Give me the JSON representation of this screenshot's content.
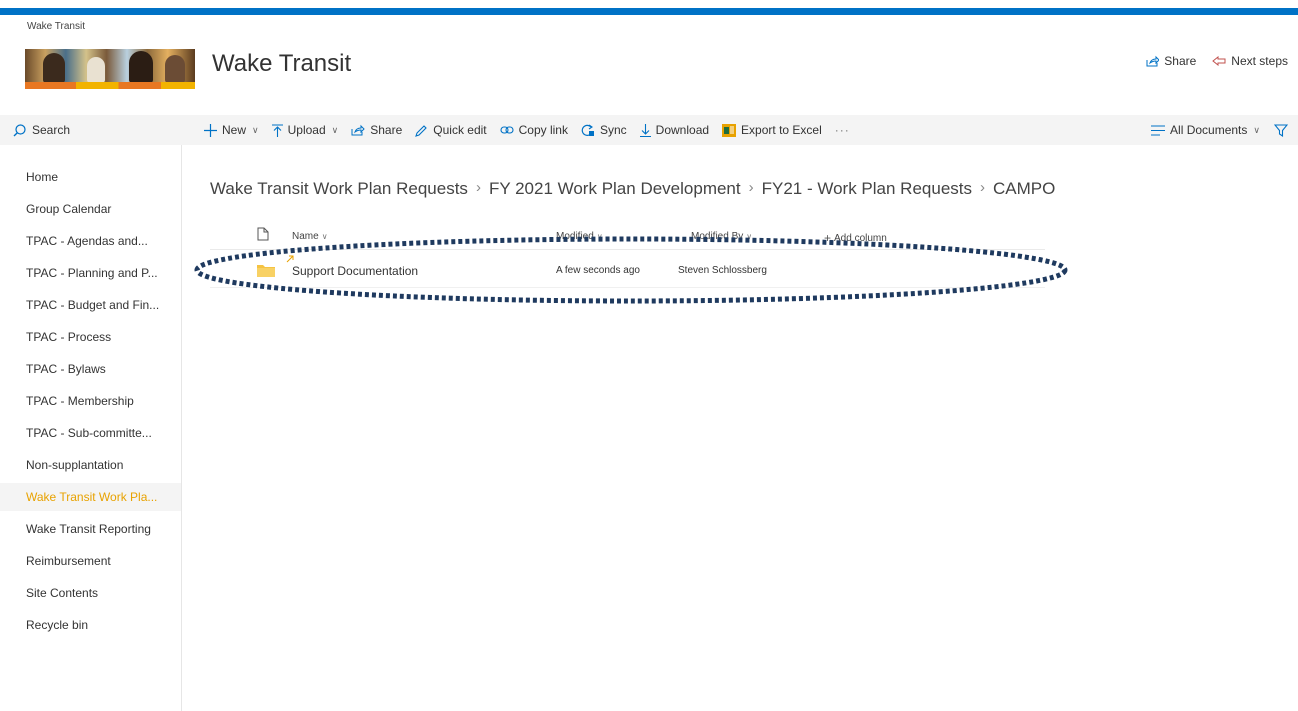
{
  "header": {
    "site_breadcrumb": "Wake Transit",
    "site_title": "Wake Transit",
    "share_label": "Share",
    "next_steps_label": "Next steps"
  },
  "search": {
    "label": "Search"
  },
  "commands": {
    "new": "New",
    "upload": "Upload",
    "share": "Share",
    "quick_edit": "Quick edit",
    "copy_link": "Copy link",
    "sync": "Sync",
    "download": "Download",
    "export": "Export to Excel",
    "more": "···",
    "view": "All Documents"
  },
  "nav": {
    "items": [
      {
        "label": "Home"
      },
      {
        "label": "Group Calendar"
      },
      {
        "label": "TPAC - Agendas and..."
      },
      {
        "label": "TPAC - Planning and P..."
      },
      {
        "label": "TPAC - Budget and Fin..."
      },
      {
        "label": "TPAC - Process"
      },
      {
        "label": "TPAC - Bylaws"
      },
      {
        "label": "TPAC - Membership"
      },
      {
        "label": "TPAC - Sub-committe..."
      },
      {
        "label": "Non-supplantation"
      },
      {
        "label": "Wake Transit Work Pla...",
        "selected": true
      },
      {
        "label": "Wake Transit Reporting"
      },
      {
        "label": "Reimbursement"
      },
      {
        "label": "Site Contents"
      },
      {
        "label": "Recycle bin"
      }
    ]
  },
  "breadcrumb": {
    "items": [
      "Wake Transit Work Plan Requests",
      "FY 2021 Work Plan Development",
      "FY21 - Work Plan Requests",
      "CAMPO"
    ]
  },
  "list": {
    "columns": {
      "name": "Name",
      "modified": "Modified",
      "modified_by": "Modified By",
      "add_column": "Add column"
    },
    "rows": [
      {
        "name": "Support Documentation",
        "modified": "A few seconds ago",
        "modified_by": "Steven Schlossberg"
      }
    ]
  },
  "colors": {
    "suite_bar": "#0072c6",
    "selected_nav": "#e8a200",
    "accent": "#0072c6",
    "folder": "#f5c342",
    "highlight_ellipse": "#1f3a5f"
  }
}
